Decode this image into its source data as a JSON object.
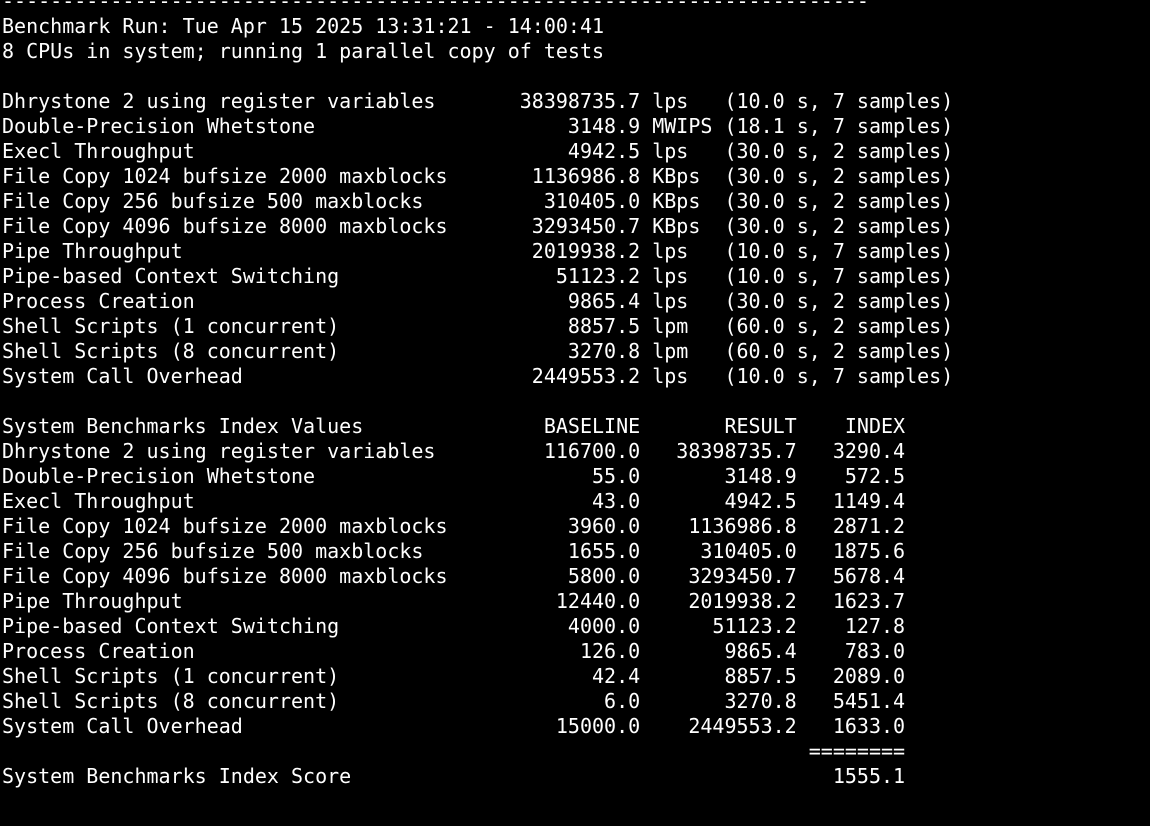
{
  "terminal": {
    "lines": [
      "------------------------------------------------------------------------",
      "Benchmark Run: Tue Apr 15 2025 13:31:21 - 14:00:41",
      "8 CPUs in system; running 1 parallel copy of tests",
      "",
      "Dhrystone 2 using register variables       38398735.7 lps   (10.0 s, 7 samples)",
      "Double-Precision Whetstone                     3148.9 MWIPS (18.1 s, 7 samples)",
      "Execl Throughput                               4942.5 lps   (30.0 s, 2 samples)",
      "File Copy 1024 bufsize 2000 maxblocks       1136986.8 KBps  (30.0 s, 2 samples)",
      "File Copy 256 bufsize 500 maxblocks          310405.0 KBps  (30.0 s, 2 samples)",
      "File Copy 4096 bufsize 8000 maxblocks       3293450.7 KBps  (30.0 s, 2 samples)",
      "Pipe Throughput                             2019938.2 lps   (10.0 s, 7 samples)",
      "Pipe-based Context Switching                  51123.2 lps   (10.0 s, 7 samples)",
      "Process Creation                               9865.4 lps   (30.0 s, 2 samples)",
      "Shell Scripts (1 concurrent)                   8857.5 lpm   (60.0 s, 2 samples)",
      "Shell Scripts (8 concurrent)                   3270.8 lpm   (60.0 s, 2 samples)",
      "System Call Overhead                        2449553.2 lps   (10.0 s, 7 samples)",
      "",
      "System Benchmarks Index Values               BASELINE       RESULT    INDEX",
      "Dhrystone 2 using register variables         116700.0   38398735.7   3290.4",
      "Double-Precision Whetstone                       55.0       3148.9    572.5",
      "Execl Throughput                                 43.0       4942.5   1149.4",
      "File Copy 1024 bufsize 2000 maxblocks          3960.0    1136986.8   2871.2",
      "File Copy 256 bufsize 500 maxblocks            1655.0     310405.0   1875.6",
      "File Copy 4096 bufsize 8000 maxblocks          5800.0    3293450.7   5678.4",
      "Pipe Throughput                               12440.0    2019938.2   1623.7",
      "Pipe-based Context Switching                   4000.0      51123.2    127.8",
      "Process Creation                                126.0       9865.4    783.0",
      "Shell Scripts (1 concurrent)                     42.4       8857.5   2089.0",
      "Shell Scripts (8 concurrent)                      6.0       3270.8   5451.4",
      "System Call Overhead                          15000.0    2449553.2   1633.0",
      "                                                                   ========",
      "System Benchmarks Index Score                                        1555.1"
    ]
  }
}
